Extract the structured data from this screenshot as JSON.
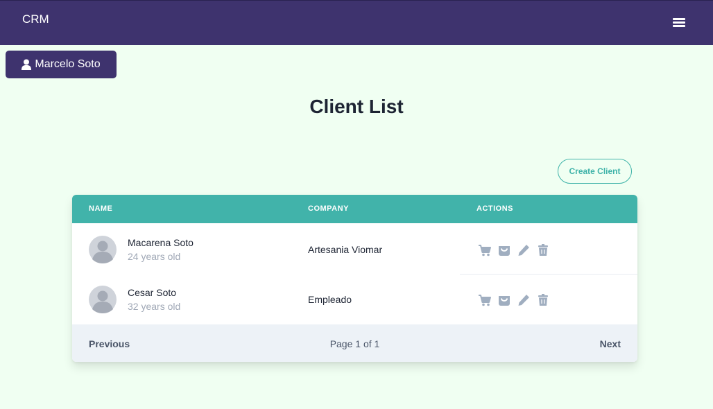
{
  "app": {
    "brand": "CRM"
  },
  "navbar": {
    "menu_icon": "hamburger-icon"
  },
  "user": {
    "name": "Marcelo Soto",
    "icon": "user-icon"
  },
  "page": {
    "title": "Client List"
  },
  "toolbar": {
    "create_label": "Create Client"
  },
  "table": {
    "columns": [
      "NAME",
      "COMPANY",
      "ACTIONS"
    ],
    "rows": [
      {
        "name": "Macarena Soto",
        "age": "24 years old",
        "company": "Artesania Viomar"
      },
      {
        "name": "Cesar Soto",
        "age": "32 years old",
        "company": "Empleado"
      }
    ],
    "action_icons": [
      "cart-icon",
      "bag-icon",
      "pencil-icon",
      "trash-icon"
    ]
  },
  "pagination": {
    "prev": "Previous",
    "info": "Page 1 of 1",
    "next": "Next"
  },
  "colors": {
    "navbar": "#3e336e",
    "accent": "#41b3aa",
    "background": "#f0fff2",
    "icon": "#a0aec0"
  }
}
